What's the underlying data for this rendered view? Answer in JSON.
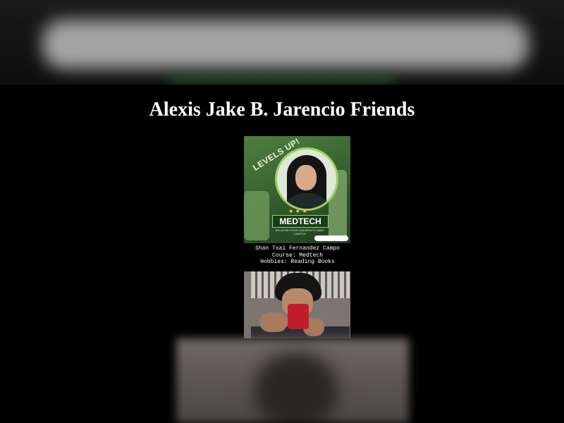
{
  "page": {
    "title": "Alexis Jake B. Jarencio Friends"
  },
  "friends": [
    {
      "poster": {
        "headline": "LEVELS UP!",
        "course_banner": "MEDTECH",
        "school": "BULACAN STATE UNIVERSITY MAIN CAMPUS"
      },
      "name": "Shan Tsai Fernandez Campo",
      "course": "Course: Medtech",
      "hobbies": "Hobbies: Reading Books"
    }
  ],
  "colors": {
    "background": "#000000",
    "title_text": "#ffffff",
    "poster_green": "#3d6a34"
  }
}
